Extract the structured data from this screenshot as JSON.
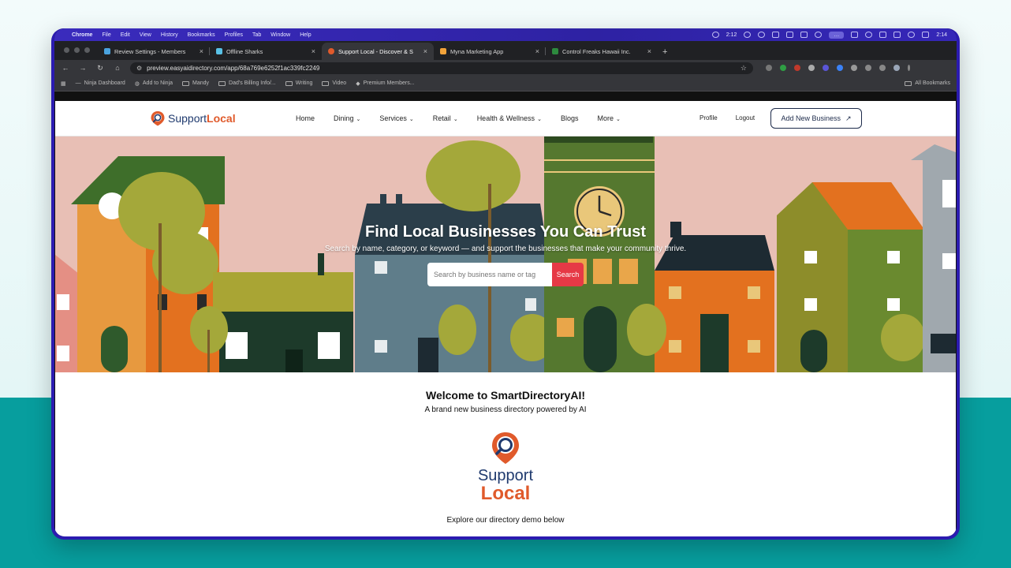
{
  "menubar": {
    "app": "Chrome",
    "items": [
      "File",
      "Edit",
      "View",
      "History",
      "Bookmarks",
      "Profiles",
      "Tab",
      "Window",
      "Help"
    ],
    "status_time_a": "2:12",
    "clock": "2:14"
  },
  "tabs": [
    {
      "label": "Review Settings - Members",
      "favicon_color": "#4aa3df",
      "active": false
    },
    {
      "label": "Offline Sharks",
      "favicon_color": "#59c1e6",
      "active": false
    },
    {
      "label": "Support Local - Discover & S",
      "favicon_color": "#e05a2b",
      "active": true
    },
    {
      "label": "Myna Marketing App",
      "favicon_color": "#f2a33a",
      "active": false
    },
    {
      "label": "Control Freaks Hawaii Inc.",
      "favicon_color": "#2d8a3e",
      "active": false
    }
  ],
  "address_bar": {
    "url": "preview.easyaidirectory.com/app/68a769e6252f1ac339fc2249"
  },
  "bookmarks": {
    "items": [
      "Ninja Dashboard",
      "Add to Ninja",
      "Mandy",
      "Dad's Billing Info/...",
      "Writing",
      "Video",
      "Premium Members..."
    ],
    "all": "All Bookmarks"
  },
  "site": {
    "logo_support": "Support",
    "logo_local": "Local",
    "nav": [
      {
        "label": "Home",
        "dropdown": false
      },
      {
        "label": "Dining",
        "dropdown": true
      },
      {
        "label": "Services",
        "dropdown": true
      },
      {
        "label": "Retail",
        "dropdown": true
      },
      {
        "label": "Health & Wellness",
        "dropdown": true
      },
      {
        "label": "Blogs",
        "dropdown": false
      },
      {
        "label": "More",
        "dropdown": true
      }
    ],
    "profile": "Profile",
    "logout": "Logout",
    "add_business": "Add New Business",
    "add_business_icon": "↗"
  },
  "hero": {
    "title": "Find Local Businesses You Can Trust",
    "subtitle": "Search by name, category, or keyword — and support the businesses that make your community thrive.",
    "search_placeholder": "Search by business name or tag",
    "search_button": "Search"
  },
  "content": {
    "welcome_title": "Welcome to SmartDirectoryAI!",
    "welcome_subtitle": "A brand new business directory powered by AI",
    "logo_support": "Support",
    "logo_local": "Local",
    "explore": "Explore our directory demo below"
  },
  "colors": {
    "accent_red": "#e63946",
    "brand_orange": "#e05a2b",
    "brand_navy": "#1f3a6e",
    "hero_sky": "#e8bfb5",
    "teal_background": "#079e9e"
  }
}
